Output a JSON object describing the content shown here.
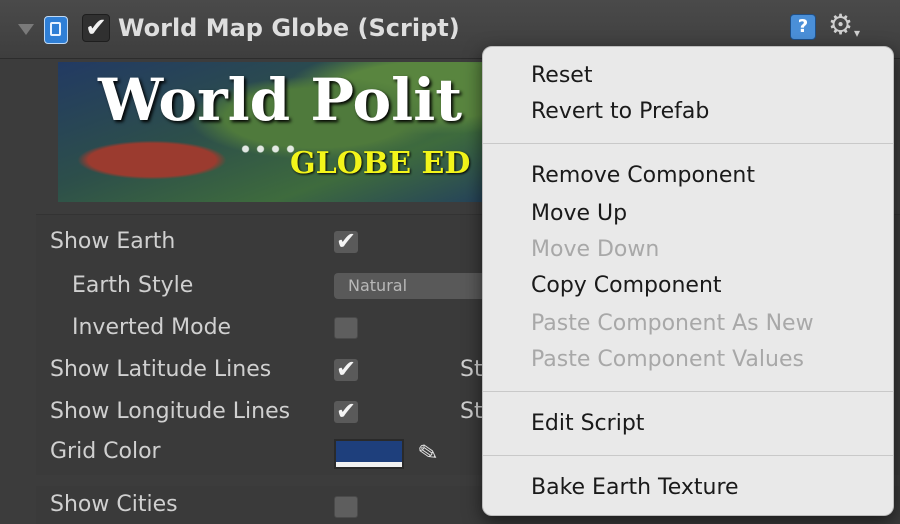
{
  "header": {
    "title": "World Map Globe (Script)",
    "enabled_check": "✔",
    "help_glyph": "?",
    "gear_glyph": "⚙",
    "gear_caret": "▾",
    "icons": [
      "fold-arrow",
      "script-icon",
      "help-icon",
      "gear-icon"
    ]
  },
  "banner": {
    "title": "World Polit",
    "subtitle": "GLOBE ED"
  },
  "properties": {
    "show_earth": {
      "label": "Show Earth",
      "checked": "✔"
    },
    "earth_style": {
      "label": "Earth Style",
      "value": "Natural"
    },
    "inverted_mode": {
      "label": "Inverted Mode",
      "checked": ""
    },
    "show_latitude_lines": {
      "label": "Show Latitude Lines",
      "checked": "✔",
      "clipped_label": "St"
    },
    "show_longitude_lines": {
      "label": "Show Longitude Lines",
      "checked": "✔",
      "clipped_label": "St"
    },
    "grid_color": {
      "label": "Grid Color",
      "swatch_color": "#1e3f7c",
      "eyedropper_glyph": "✎"
    },
    "show_cities": {
      "label": "Show Cities",
      "checked": ""
    }
  },
  "context_menu": {
    "items": [
      {
        "label": "Reset",
        "enabled": true
      },
      {
        "label": "Revert to Prefab",
        "enabled": true
      },
      {
        "label": "Remove Component",
        "enabled": true
      },
      {
        "label": "Move Up",
        "enabled": true
      },
      {
        "label": "Move Down",
        "enabled": false
      },
      {
        "label": "Copy Component",
        "enabled": true
      },
      {
        "label": "Paste Component As New",
        "enabled": false
      },
      {
        "label": "Paste Component Values",
        "enabled": false
      },
      {
        "label": "Edit Script",
        "enabled": true
      },
      {
        "label": "Bake Earth Texture",
        "enabled": true
      }
    ]
  },
  "colors": {
    "panel_bg": "#3c3c3c",
    "menu_bg": "#e9e9e9",
    "menu_text": "#1a1a1a",
    "menu_text_disabled": "#a8a8a8",
    "banner_subtitle": "#f3f51a"
  }
}
